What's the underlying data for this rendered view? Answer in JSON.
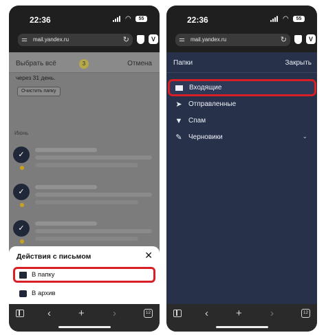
{
  "status": {
    "time": "22:36",
    "battery": "55",
    "wifi_icon": "wifi-icon"
  },
  "browser": {
    "url": "mail.yandex.ru",
    "tabs_count": "12"
  },
  "left": {
    "select_all": "Выбрать всё",
    "selected_count": "3",
    "cancel": "Отмена",
    "trash_note": "через 31 день.",
    "clear_folder": "Очистить папку",
    "month": "Июнь",
    "sheet": {
      "title": "Действия с письмом",
      "items": [
        {
          "label": "В папку",
          "icon": "folder-icon"
        },
        {
          "label": "В архив",
          "icon": "archive-icon"
        }
      ]
    }
  },
  "right": {
    "header_title": "Папки",
    "header_close": "Закрыть",
    "folders": [
      {
        "label": "Входящие",
        "icon": "envelope-icon"
      },
      {
        "label": "Отправленные",
        "icon": "paper-plane-icon"
      },
      {
        "label": "Спам",
        "icon": "thumbs-down-icon"
      },
      {
        "label": "Черновики",
        "icon": "pencil-icon"
      }
    ]
  },
  "colors": {
    "highlight": "#d81f26",
    "folder_panel": "#27314a",
    "check_badge": "#1f2738",
    "unread_dot": "#c9a21a"
  }
}
